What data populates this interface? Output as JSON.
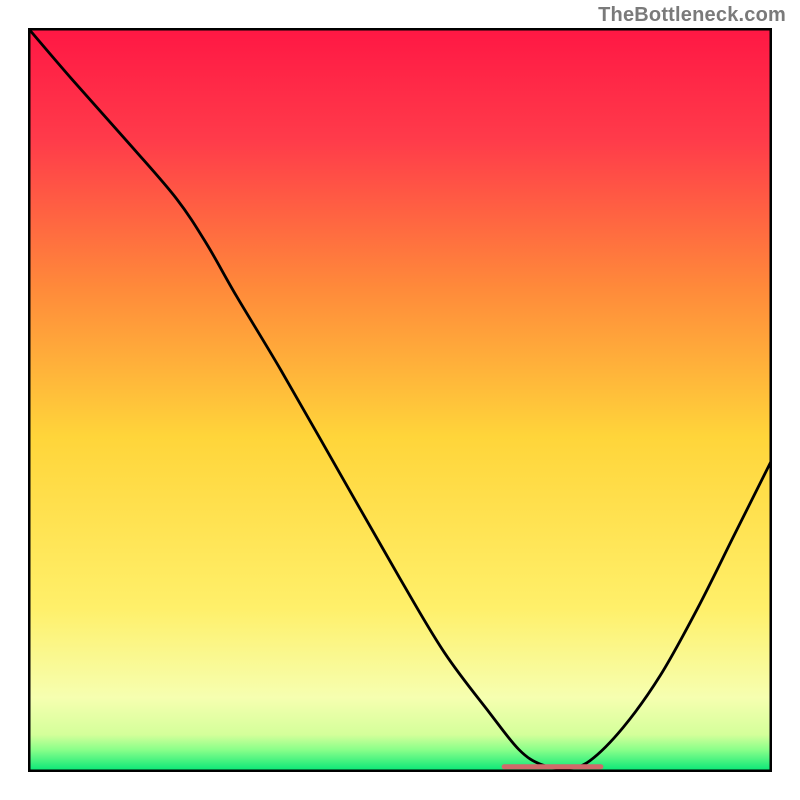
{
  "watermark": "TheBottleneck.com",
  "chart_data": {
    "type": "line",
    "title": "",
    "xlabel": "",
    "ylabel": "",
    "xlim": [
      0,
      100
    ],
    "ylim": [
      0,
      100
    ],
    "grid": false,
    "background_gradient": {
      "stops": [
        {
          "offset": 0.0,
          "color": "#ff1744"
        },
        {
          "offset": 0.15,
          "color": "#ff3b4a"
        },
        {
          "offset": 0.35,
          "color": "#ff8a3a"
        },
        {
          "offset": 0.55,
          "color": "#ffd53a"
        },
        {
          "offset": 0.78,
          "color": "#fff06a"
        },
        {
          "offset": 0.9,
          "color": "#f6ffb0"
        },
        {
          "offset": 0.95,
          "color": "#d4ff9a"
        },
        {
          "offset": 0.97,
          "color": "#8aff8a"
        },
        {
          "offset": 1.0,
          "color": "#00e676"
        }
      ]
    },
    "series": [
      {
        "name": "curve",
        "color": "#000000",
        "width": 2.8,
        "x": [
          0.0,
          6.0,
          14.0,
          20.0,
          24.0,
          28.0,
          34.0,
          42.0,
          50.0,
          56.0,
          62.0,
          66.0,
          69.0,
          72.5,
          75.5,
          80.0,
          85.0,
          90.0,
          95.0,
          100.0
        ],
        "y": [
          100.0,
          93.0,
          84.0,
          77.0,
          71.0,
          64.0,
          54.0,
          40.0,
          26.0,
          16.0,
          8.0,
          3.0,
          1.0,
          0.5,
          1.5,
          6.0,
          13.0,
          22.0,
          32.0,
          42.0
        ]
      }
    ],
    "flat_segment": {
      "x_start": 64.0,
      "x_end": 77.0,
      "y": 0.7,
      "color": "#d06a6a",
      "width": 5
    },
    "axes": {
      "show_ticks": false,
      "frame_color": "#000000",
      "frame_width": 5
    }
  }
}
